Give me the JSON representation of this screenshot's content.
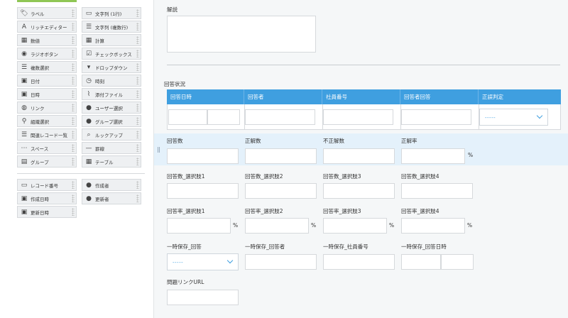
{
  "palette": {
    "items": [
      {
        "label": "ラベル",
        "icon": "tag-icon"
      },
      {
        "label": "文字列 (1行)",
        "icon": "text-single-icon"
      },
      {
        "label": "リッチエディター",
        "icon": "rich-editor-icon"
      },
      {
        "label": "文字列 (複数行)",
        "icon": "text-multi-icon"
      },
      {
        "label": "数値",
        "icon": "number-icon"
      },
      {
        "label": "計算",
        "icon": "calculator-icon"
      },
      {
        "label": "ラジオボタン",
        "icon": "radio-icon"
      },
      {
        "label": "チェックボックス",
        "icon": "checkbox-icon"
      },
      {
        "label": "複数選択",
        "icon": "multi-select-icon"
      },
      {
        "label": "ドロップダウン",
        "icon": "dropdown-icon"
      },
      {
        "label": "日付",
        "icon": "date-icon"
      },
      {
        "label": "時刻",
        "icon": "clock-icon"
      },
      {
        "label": "日時",
        "icon": "datetime-icon"
      },
      {
        "label": "添付ファイル",
        "icon": "attachment-icon"
      },
      {
        "label": "リンク",
        "icon": "globe-icon"
      },
      {
        "label": "ユーザー選択",
        "icon": "user-icon"
      },
      {
        "label": "組織選択",
        "icon": "org-icon"
      },
      {
        "label": "グループ選択",
        "icon": "group-icon"
      },
      {
        "label": "関連レコード一覧",
        "icon": "related-records-icon"
      },
      {
        "label": "ルックアップ",
        "icon": "lookup-icon"
      },
      {
        "label": "スペース",
        "icon": "space-icon"
      },
      {
        "label": "罫線",
        "icon": "rule-icon"
      },
      {
        "label": "グループ",
        "icon": "folder-group-icon"
      },
      {
        "label": "テーブル",
        "icon": "table-icon"
      },
      {
        "label": "レコード番号",
        "icon": "record-number-icon"
      },
      {
        "label": "作成者",
        "icon": "creator-icon"
      },
      {
        "label": "作成日時",
        "icon": "created-datetime-icon"
      },
      {
        "label": "更新者",
        "icon": "updater-icon"
      },
      {
        "label": "更新日時",
        "icon": "updated-datetime-icon"
      }
    ]
  },
  "form": {
    "explanation_label": "解説",
    "answer_status_label": "回答状況",
    "table_headers": [
      "回答日時",
      "回答者",
      "社員番号",
      "回答者回答",
      "正誤判定"
    ],
    "dropdown_placeholder": "-----",
    "row1": [
      "回答数",
      "正解数",
      "不正解数",
      "正解率"
    ],
    "percent": "%",
    "row2": [
      "回答数_選択肢1",
      "回答数_選択肢2",
      "回答数_選択肢3",
      "回答数_選択肢4"
    ],
    "row3": [
      "回答率_選択肢1",
      "回答率_選択肢2",
      "回答率_選択肢3",
      "回答率_選択肢4"
    ],
    "row4": [
      "一時保存_回答",
      "一時保存_回答者",
      "一時保存_社員番号",
      "一時保存_回答日時"
    ],
    "url_label": "問題リンクURL"
  },
  "colors": {
    "accent_green": "#8fc655",
    "table_header_blue": "#3f9fe0",
    "highlight_band": "#e4f1fb"
  }
}
